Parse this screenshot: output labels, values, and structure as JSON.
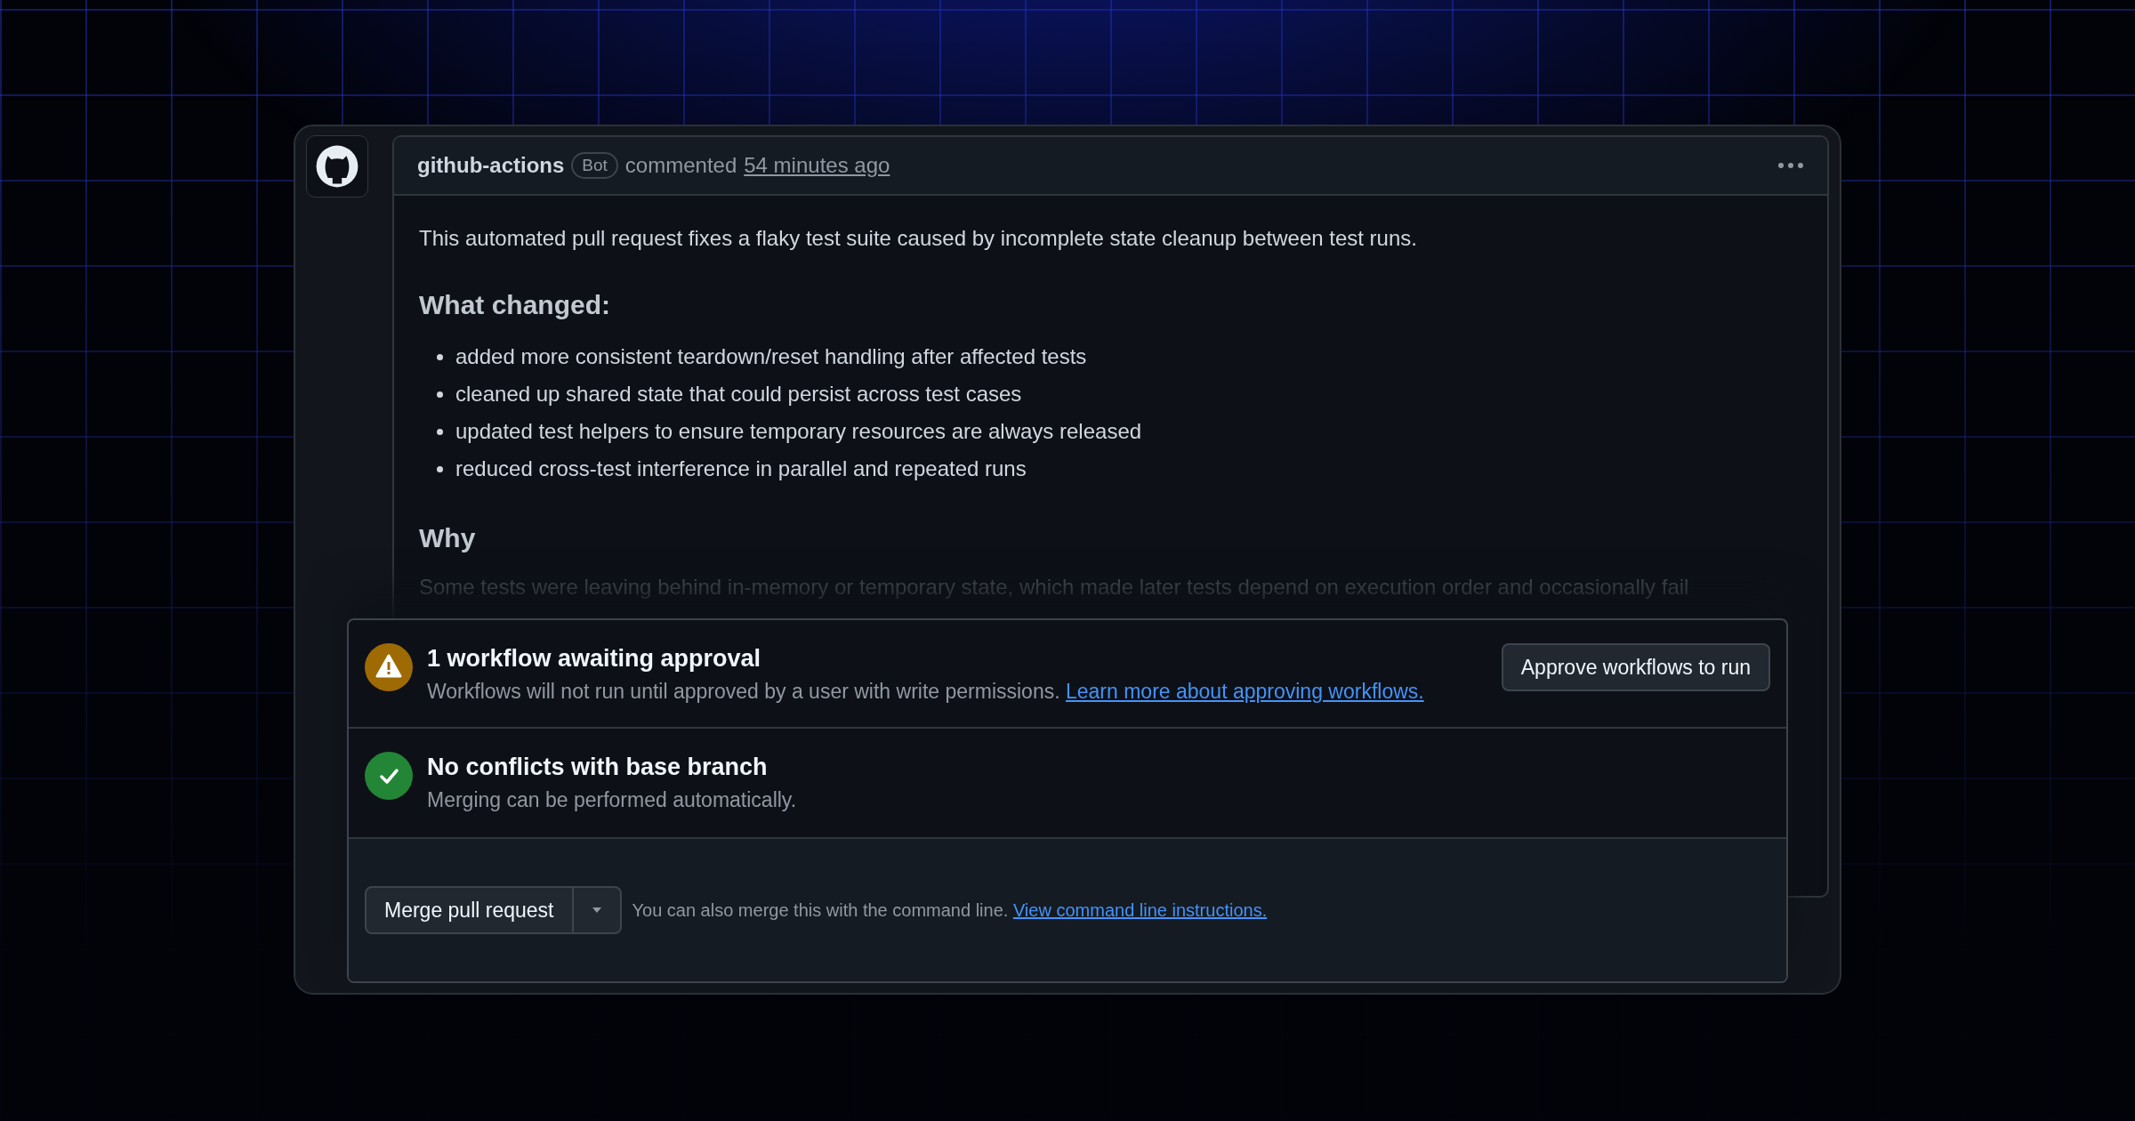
{
  "comment": {
    "author": "github-actions",
    "badge": "Bot",
    "action": "commented",
    "time": "54 minutes ago",
    "intro": "This automated pull request fixes a flaky test suite caused by incomplete state cleanup between test runs.",
    "sections": [
      {
        "heading": "What changed:",
        "items": [
          "added more consistent teardown/reset handling after affected tests",
          "cleaned up shared state that could persist across test cases",
          "updated test helpers to ensure temporary resources are always released",
          "reduced cross-test interference in parallel and repeated runs"
        ]
      },
      {
        "heading": "Why",
        "paragraph": "Some tests were leaving behind in-memory or temporary state, which made later tests depend on execution order and occasionally fail"
      }
    ]
  },
  "merge_box": {
    "checks": [
      {
        "kind": "warning",
        "title": "1 workflow awaiting approval",
        "description": "Workflows will not run until approved by a user with write permissions.",
        "link": "Learn more about approving workflows.",
        "button": "Approve workflows to run"
      },
      {
        "kind": "success",
        "title": "No conflicts with base branch",
        "description": "Merging can be performed automatically."
      }
    ],
    "merge": {
      "button": "Merge pull request",
      "note": "You can also merge this with the command line.",
      "link": "View command line instructions."
    }
  }
}
